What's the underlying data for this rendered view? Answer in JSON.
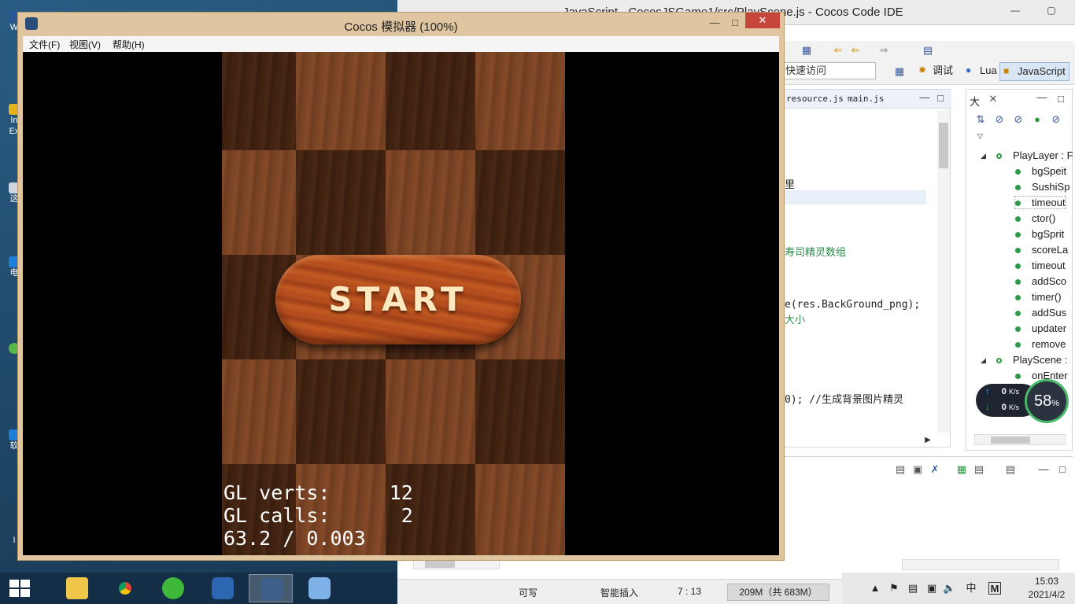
{
  "ide": {
    "title": "JavaScript - CocosJSGame1/src/PlayScene.js - Cocos Code IDE",
    "quick_access": "快速访问",
    "perspectives": [
      "调试",
      "Lua",
      "JavaScript"
    ],
    "editor_tabs": [
      "resource.js",
      "main.js"
    ],
    "code_lines": [
      {
        "text": "里",
        "comment": false
      },
      {
        "text": "寿司精灵数组",
        "comment": true
      },
      {
        "text": "e(res.BackGround_png);",
        "comment": false
      },
      {
        "text": "大小",
        "comment": true
      },
      {
        "text": "0);  //生成背景图片精灵",
        "comment": false
      }
    ],
    "outline_tab": "大",
    "outline": [
      {
        "label": "PlayLayer : F",
        "kind": "class"
      },
      {
        "label": "bgSpeit",
        "kind": "member"
      },
      {
        "label": "SushiSp",
        "kind": "member"
      },
      {
        "label": "timeout",
        "kind": "member"
      },
      {
        "label": "ctor()",
        "kind": "member"
      },
      {
        "label": "bgSprit",
        "kind": "member"
      },
      {
        "label": "scoreLa",
        "kind": "member"
      },
      {
        "label": "timeout",
        "kind": "member"
      },
      {
        "label": "addSco",
        "kind": "member"
      },
      {
        "label": "timer()",
        "kind": "member"
      },
      {
        "label": "addSus",
        "kind": "member"
      },
      {
        "label": "updater",
        "kind": "member"
      },
      {
        "label": "remove",
        "kind": "member"
      },
      {
        "label": "PlayScene :",
        "kind": "class"
      },
      {
        "label": "onEnter",
        "kind": "member"
      }
    ],
    "status": {
      "writable": "可写",
      "insert_mode": "智能插入",
      "position": "7 : 13",
      "heap": "209M（共 683M）"
    }
  },
  "network": {
    "upload": "0",
    "download": "0",
    "unit": "K/s",
    "percent": "58",
    "percent_sign": "%"
  },
  "simulator": {
    "title": "Cocos 模拟器 (100%)",
    "menu": [
      "文件(F)",
      "视图(V)",
      "帮助(H)"
    ],
    "start_label": "START",
    "stats": [
      "GL verts:     12",
      "GL calls:      2",
      "63.2 / 0.003"
    ]
  },
  "desktop_icon_labels": [
    "W",
    "In",
    "Ex",
    "这",
    "电",
    "软",
    "I"
  ],
  "clock": {
    "time": "15:03",
    "date": "2021/4/2"
  },
  "tray": {
    "ime_chinese": "中",
    "ime_mode": "M"
  },
  "colors": {
    "sim_frame": "#dfc6a1",
    "close_button": "#c7463b",
    "network_ring": "#46b86a"
  }
}
